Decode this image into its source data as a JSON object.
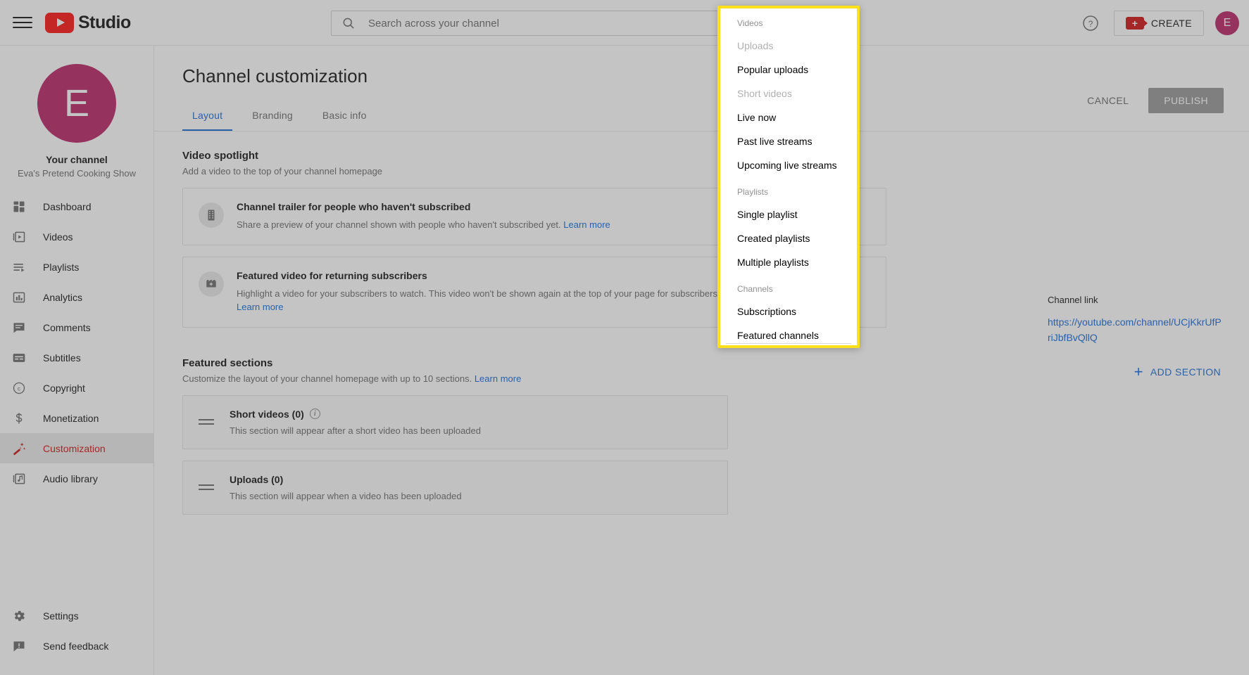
{
  "header": {
    "menu_icon": "hamburger-icon",
    "brand": "Studio",
    "search_placeholder": "Search across your channel",
    "search_value": "",
    "help_icon": "help-icon",
    "create_label": "CREATE",
    "avatar_initial": "E"
  },
  "sidebar": {
    "channel_label": "Your channel",
    "channel_name": "Eva's Pretend Cooking Show",
    "avatar_initial": "E",
    "items": [
      {
        "label": "Dashboard",
        "icon": "dashboard-icon",
        "active": false
      },
      {
        "label": "Videos",
        "icon": "video-icon",
        "active": false
      },
      {
        "label": "Playlists",
        "icon": "playlist-icon",
        "active": false
      },
      {
        "label": "Analytics",
        "icon": "analytics-icon",
        "active": false
      },
      {
        "label": "Comments",
        "icon": "comment-icon",
        "active": false
      },
      {
        "label": "Subtitles",
        "icon": "subtitles-icon",
        "active": false
      },
      {
        "label": "Copyright",
        "icon": "copyright-icon",
        "active": false
      },
      {
        "label": "Monetization",
        "icon": "dollar-icon",
        "active": false
      },
      {
        "label": "Customization",
        "icon": "wand-icon",
        "active": true
      },
      {
        "label": "Audio library",
        "icon": "music-icon",
        "active": false
      }
    ],
    "bottom_items": [
      {
        "label": "Settings",
        "icon": "gear-icon"
      },
      {
        "label": "Send feedback",
        "icon": "feedback-icon"
      }
    ]
  },
  "main": {
    "page_title": "Channel customization",
    "tabs": [
      {
        "label": "Layout",
        "active": true
      },
      {
        "label": "Branding",
        "active": false
      },
      {
        "label": "Basic info",
        "active": false
      }
    ],
    "cancel_label": "CANCEL",
    "publish_label": "PUBLISH",
    "video_spotlight": {
      "title": "Video spotlight",
      "description": "Add a video to the top of your channel homepage",
      "cards": [
        {
          "icon": "film-strip-icon",
          "title": "Channel trailer for people who haven't subscribed",
          "description": "Share a preview of your channel shown with people who haven't subscribed yet.",
          "link": "Learn more"
        },
        {
          "icon": "featured-video-icon",
          "title": "Featured video for returning subscribers",
          "description": "Highlight a video for your subscribers to watch. This video won't be shown again at the top of your page for subscribers who have already watched it.",
          "link": "Learn more"
        }
      ]
    },
    "featured_sections": {
      "title": "Featured sections",
      "description": "Customize the layout of your channel homepage with up to 10 sections.",
      "link": "Learn more",
      "add_label": "ADD SECTION",
      "rows": [
        {
          "title": "Short videos (0)",
          "description": "This section will appear after a short video has been uploaded",
          "has_info": true
        },
        {
          "title": "Uploads (0)",
          "description": "This section will appear when a video has been uploaded",
          "has_info": false
        }
      ]
    },
    "channel_link": {
      "label": "Channel link",
      "url": "https://youtube.com/channel/UCjKkrUfPriJbfBvQllQ"
    }
  },
  "dropdown": {
    "groups": [
      {
        "label": "Videos",
        "items": [
          {
            "label": "Uploads",
            "disabled": true
          },
          {
            "label": "Popular uploads",
            "disabled": false
          },
          {
            "label": "Short videos",
            "disabled": true
          },
          {
            "label": "Live now",
            "disabled": false
          },
          {
            "label": "Past live streams",
            "disabled": false
          },
          {
            "label": "Upcoming live streams",
            "disabled": false
          }
        ]
      },
      {
        "label": "Playlists",
        "items": [
          {
            "label": "Single playlist",
            "disabled": false
          },
          {
            "label": "Created playlists",
            "disabled": false
          },
          {
            "label": "Multiple playlists",
            "disabled": false
          }
        ]
      },
      {
        "label": "Channels",
        "items": [
          {
            "label": "Subscriptions",
            "disabled": false
          },
          {
            "label": "Featured channels",
            "disabled": false
          }
        ]
      }
    ]
  },
  "colors": {
    "brand_red": "#ff0000",
    "accent_blue": "#065fd4",
    "avatar_bg": "#b4145a",
    "highlight_yellow": "#ffe01b",
    "active_red": "#cc0000"
  }
}
